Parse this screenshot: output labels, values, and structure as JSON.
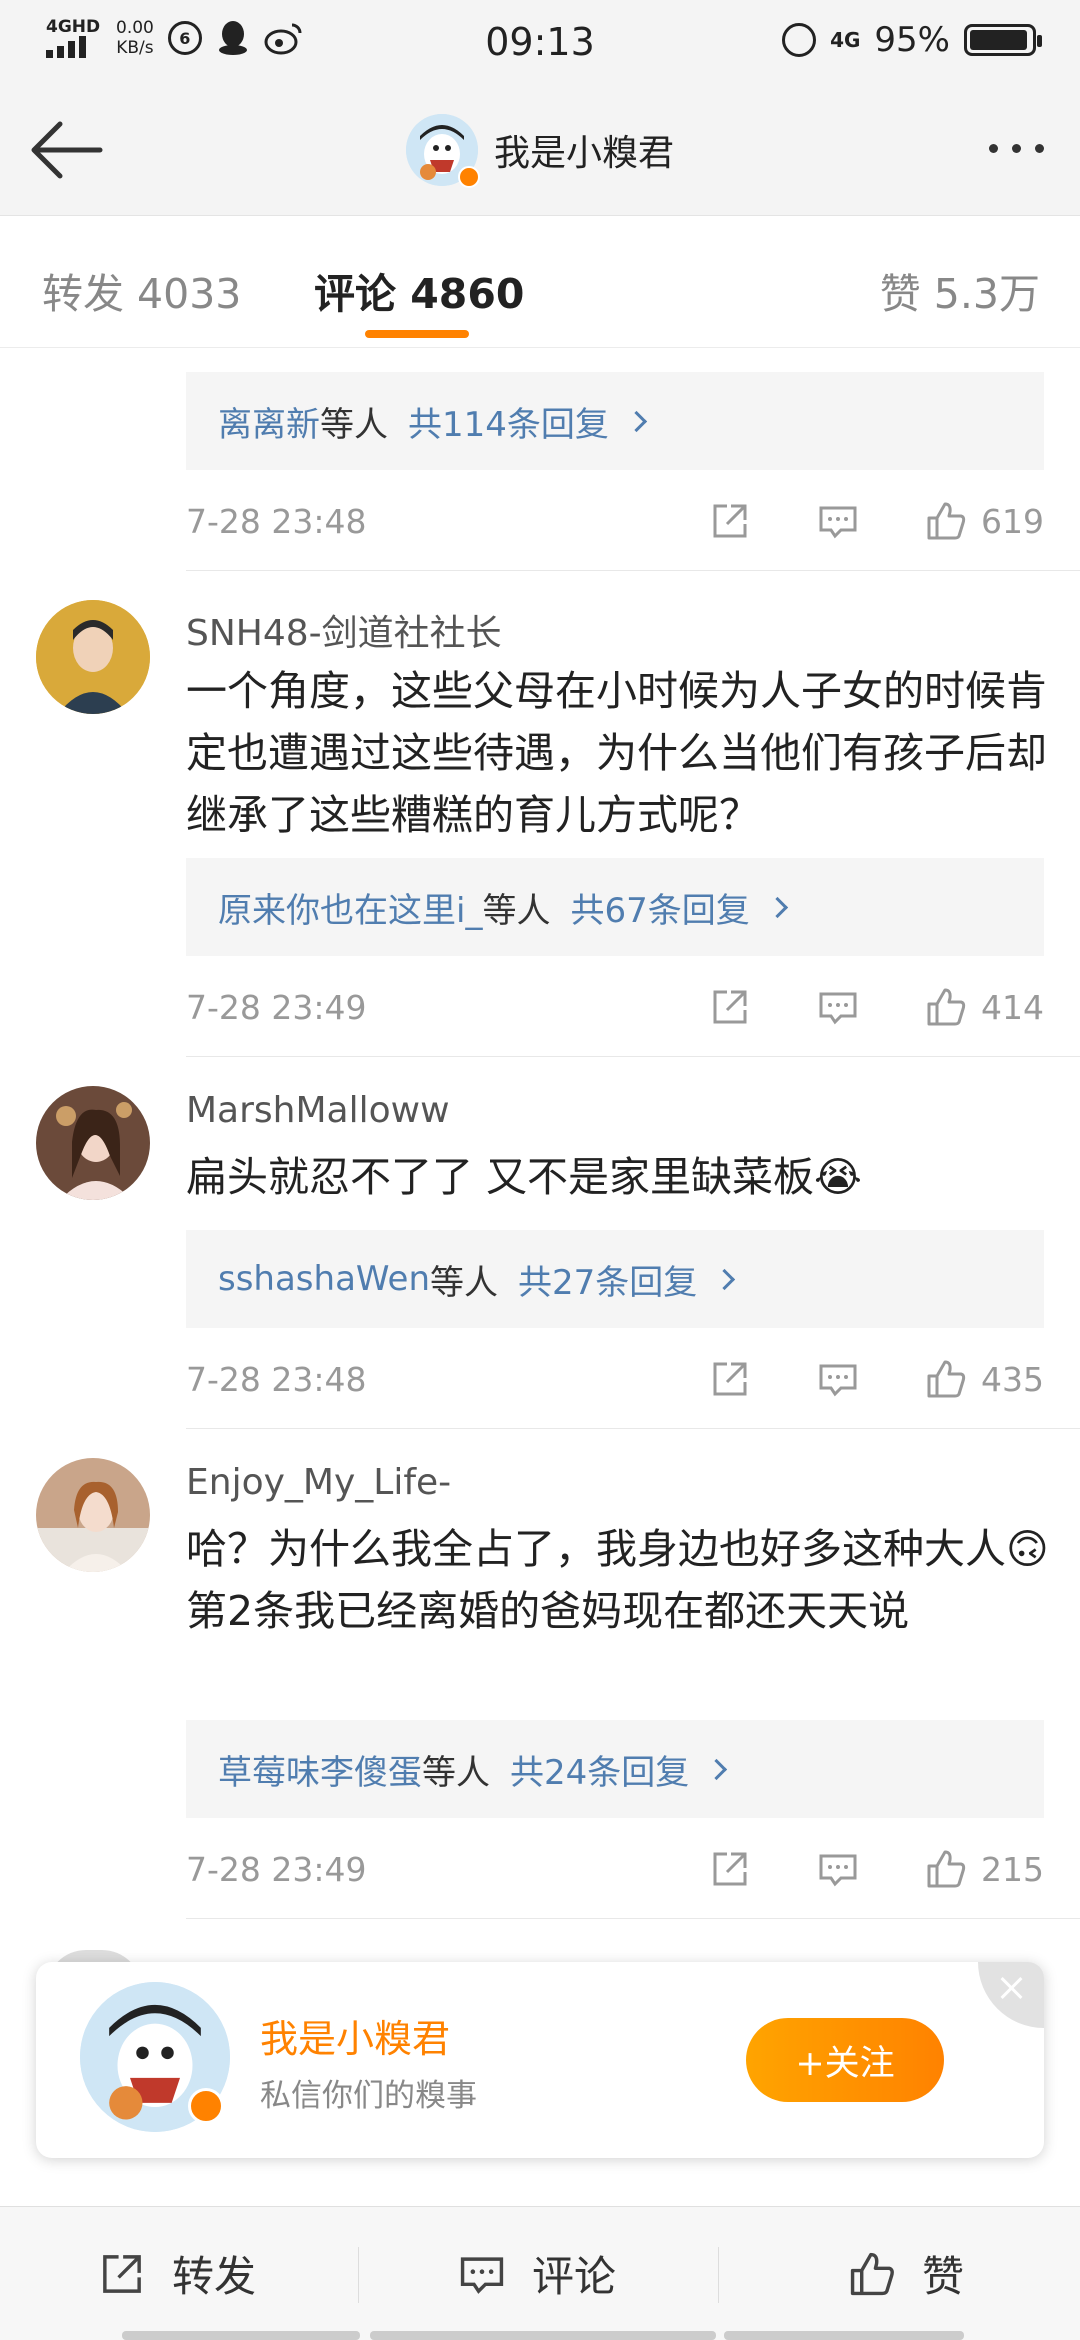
{
  "status_bar": {
    "network": "4GHD",
    "speed_value": "0.00",
    "speed_unit": "KB/s",
    "time": "09:13",
    "network_right": "4G",
    "battery": "95%",
    "battery_level": 0.95
  },
  "header": {
    "title": "我是小糗君",
    "back_icon": "arrow-left-icon",
    "more_icon": "more-dots-icon"
  },
  "tabs": {
    "repost": "转发 4033",
    "comment": "评论 4860",
    "like": "赞 5.3万"
  },
  "comments": [
    {
      "reply_users": "离离新",
      "reply_etc": "等人",
      "reply_count": "共114条回复",
      "time": "7-28 23:48",
      "likes": "619"
    },
    {
      "username": "SNH48-剑道社社长",
      "text": "一个角度，这些父母在小时候为人子女的时候肯定也遭遇过这些待遇，为什么当他们有孩子后却继承了这些糟糕的育儿方式呢？",
      "reply_users": "原来你也在这里i_",
      "reply_etc": "等人",
      "reply_count": "共67条回复",
      "time": "7-28 23:49",
      "likes": "414"
    },
    {
      "username": "MarshMalloww",
      "text": "扁头就忍不了了 又不是家里缺菜板😭",
      "reply_users": "sshashaWen",
      "reply_etc": "等人",
      "reply_count": "共27条回复",
      "time": "7-28 23:48",
      "likes": "435"
    },
    {
      "username": "Enjoy_My_Life-",
      "text": "哈？为什么我全占了，我身边也好多这种大人🙃第2条我已经离婚的爸妈现在都还天天说",
      "reply_users": "草莓味李傻蛋",
      "reply_etc": "等人",
      "reply_count": "共24条回复",
      "time": "7-28 23:49",
      "likes": "215"
    }
  ],
  "follow_card": {
    "name": "我是小糗君",
    "desc": "私信你们的糗事",
    "button": "+关注"
  },
  "bottom_bar": {
    "repost": "转发",
    "comment": "评论",
    "like": "赞"
  },
  "colors": {
    "accent": "#ff8200",
    "link": "#507daf",
    "muted": "#999999"
  }
}
